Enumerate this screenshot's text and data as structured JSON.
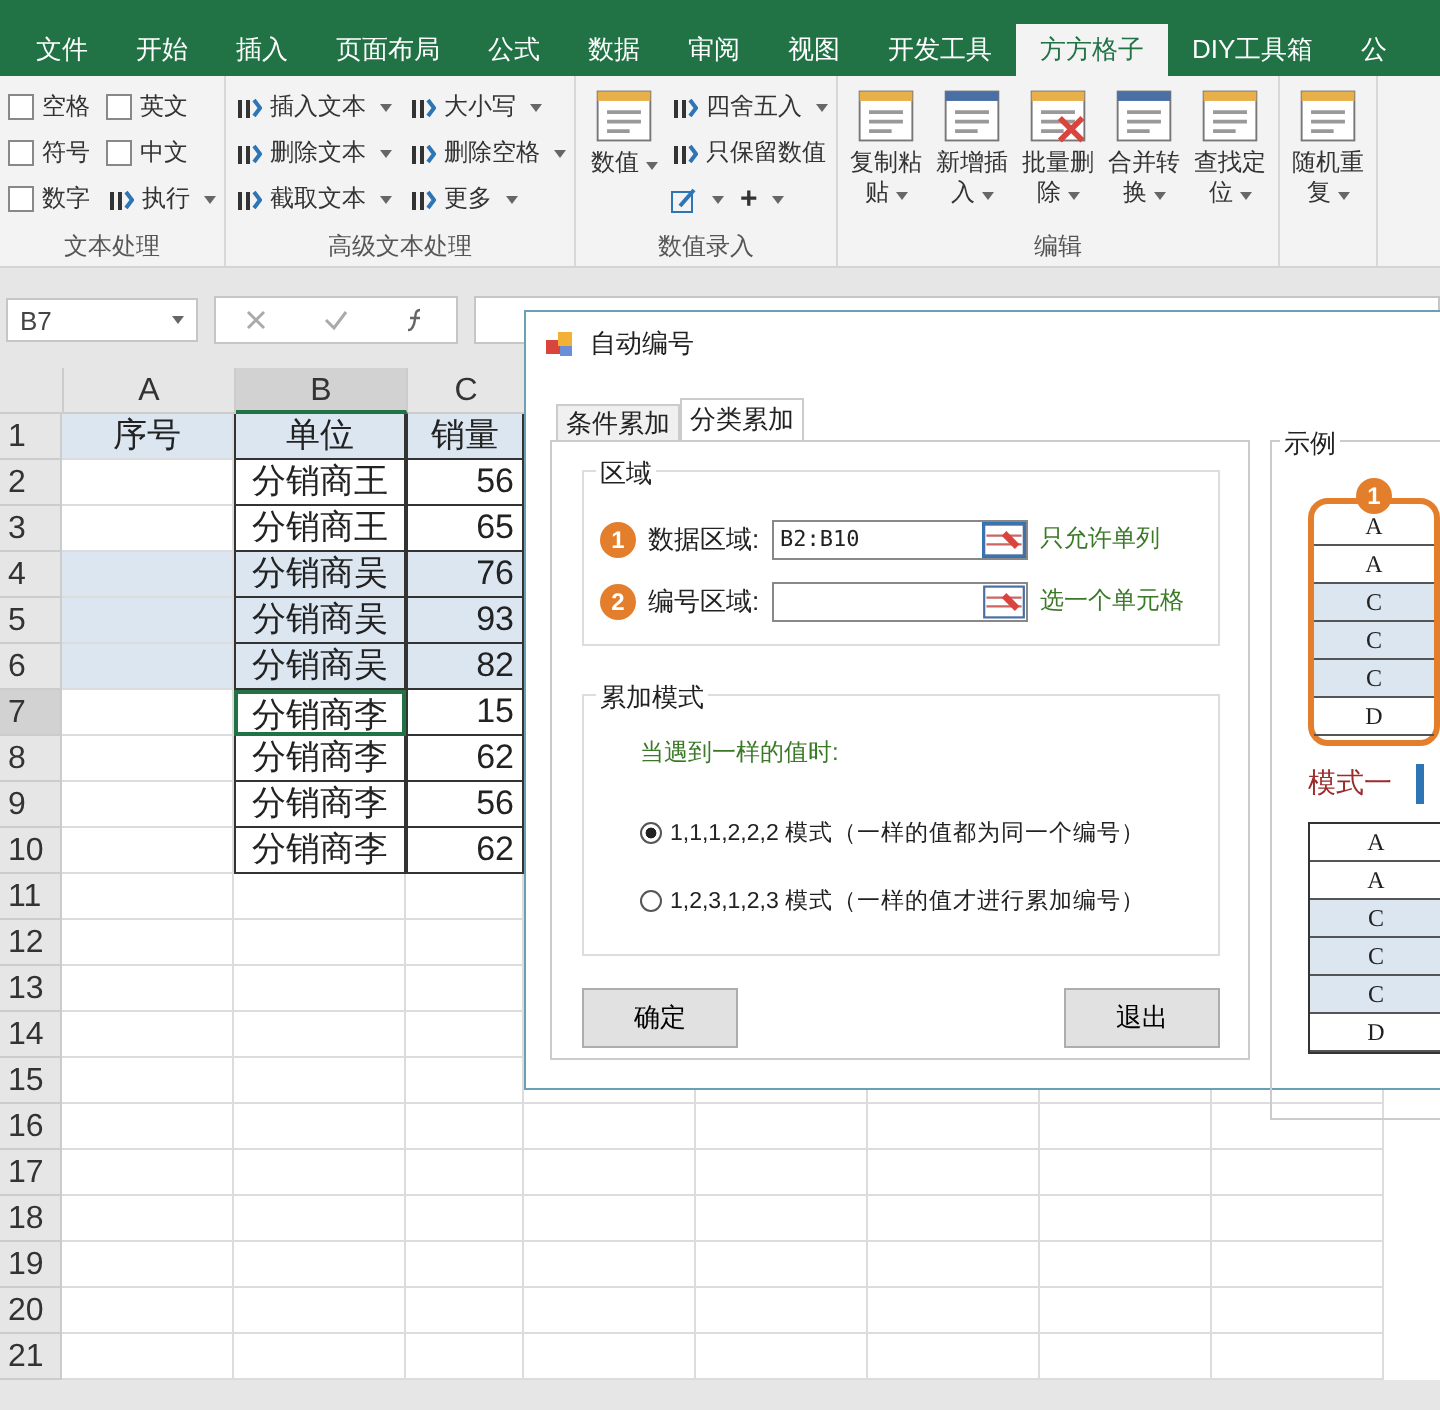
{
  "menu_tabs": [
    {
      "label": "文件",
      "selected": false
    },
    {
      "label": "开始",
      "selected": false
    },
    {
      "label": "插入",
      "selected": false
    },
    {
      "label": "页面布局",
      "selected": false
    },
    {
      "label": "公式",
      "selected": false
    },
    {
      "label": "数据",
      "selected": false
    },
    {
      "label": "审阅",
      "selected": false
    },
    {
      "label": "视图",
      "selected": false
    },
    {
      "label": "开发工具",
      "selected": false
    },
    {
      "label": "方方格子",
      "selected": true
    },
    {
      "label": "DIY工具箱",
      "selected": false
    },
    {
      "label": "公",
      "selected": false
    }
  ],
  "ribbon_groups": [
    {
      "label": "文本处理",
      "items": [
        {
          "kind": "checkbox",
          "label": "空格",
          "checked": false
        },
        {
          "kind": "checkbox",
          "label": "符号",
          "checked": false
        },
        {
          "kind": "checkbox",
          "label": "数字",
          "checked": false
        },
        {
          "kind": "checkbox",
          "label": "英文",
          "checked": false
        },
        {
          "kind": "checkbox",
          "label": "中文",
          "checked": false
        },
        {
          "kind": "small",
          "label": "执行",
          "dropdown": true
        }
      ]
    },
    {
      "label": "高级文本处理",
      "items": [
        {
          "kind": "small",
          "label": "插入文本",
          "dropdown": true
        },
        {
          "kind": "small",
          "label": "删除文本",
          "dropdown": true
        },
        {
          "kind": "small",
          "label": "截取文本",
          "dropdown": true
        },
        {
          "kind": "small",
          "label": "大小写",
          "dropdown": true
        },
        {
          "kind": "small",
          "label": "删除空格",
          "dropdown": true
        },
        {
          "kind": "small",
          "label": "更多",
          "dropdown": true
        }
      ]
    },
    {
      "label": "数值录入",
      "items": [
        {
          "kind": "big",
          "label": "数值",
          "dropdown": true
        },
        {
          "kind": "small",
          "label": "四舍五入",
          "dropdown": true
        },
        {
          "kind": "small",
          "label": "只保留数值",
          "dropdown": false
        },
        {
          "kind": "pair",
          "label": "+",
          "dropdown": true
        }
      ]
    },
    {
      "label": "编辑",
      "items": [
        {
          "kind": "big",
          "label": "复制粘贴",
          "dropdown": true
        },
        {
          "kind": "big",
          "label": "新增插入",
          "dropdown": true
        },
        {
          "kind": "big",
          "label": "批量删除",
          "dropdown": true
        },
        {
          "kind": "big",
          "label": "合并转换",
          "dropdown": true
        },
        {
          "kind": "big",
          "label": "查找定位",
          "dropdown": true
        }
      ]
    },
    {
      "items": [
        {
          "kind": "big",
          "label": "随机重复",
          "dropdown": true
        }
      ]
    }
  ],
  "name_box": "B7",
  "columns": [
    {
      "label": "A",
      "selected": false
    },
    {
      "label": "B",
      "selected": true
    },
    {
      "label": "C",
      "selected": false
    }
  ],
  "rows": [
    {
      "number": "1",
      "kind": "header",
      "selected": false,
      "shaded": true,
      "seq": "序号",
      "unit": "单位",
      "sales": "销量"
    },
    {
      "number": "2",
      "kind": "data",
      "selected": false,
      "shaded": false,
      "unit": "分销商王",
      "sales": "56"
    },
    {
      "number": "3",
      "kind": "data",
      "selected": false,
      "shaded": false,
      "unit": "分销商王",
      "sales": "65"
    },
    {
      "number": "4",
      "kind": "data",
      "selected": false,
      "shaded": true,
      "unit": "分销商吴",
      "sales": "76"
    },
    {
      "number": "5",
      "kind": "data",
      "selected": false,
      "shaded": true,
      "unit": "分销商吴",
      "sales": "93"
    },
    {
      "number": "6",
      "kind": "data",
      "selected": false,
      "shaded": true,
      "unit": "分销商吴",
      "sales": "82"
    },
    {
      "number": "7",
      "kind": "data",
      "selected": true,
      "shaded": false,
      "unit": "分销商李",
      "sales": "15"
    },
    {
      "number": "8",
      "kind": "data",
      "selected": false,
      "shaded": false,
      "unit": "分销商李",
      "sales": "62"
    },
    {
      "number": "9",
      "kind": "data",
      "selected": false,
      "shaded": false,
      "unit": "分销商李",
      "sales": "56"
    },
    {
      "number": "10",
      "kind": "data",
      "selected": false,
      "shaded": false,
      "unit": "分销商李",
      "sales": "62"
    },
    {
      "number": "11",
      "kind": "empty",
      "selected": false,
      "shaded": false
    },
    {
      "number": "12",
      "kind": "empty",
      "selected": false,
      "shaded": false
    },
    {
      "number": "13",
      "kind": "empty",
      "selected": false,
      "shaded": false
    },
    {
      "number": "14",
      "kind": "empty",
      "selected": false,
      "shaded": false
    },
    {
      "number": "15",
      "kind": "empty",
      "selected": false,
      "shaded": false
    },
    {
      "number": "16",
      "kind": "empty",
      "selected": false,
      "shaded": false
    },
    {
      "number": "17",
      "kind": "empty",
      "selected": false,
      "shaded": false
    },
    {
      "number": "18",
      "kind": "empty",
      "selected": false,
      "shaded": false
    },
    {
      "number": "19",
      "kind": "empty",
      "selected": false,
      "shaded": false
    },
    {
      "number": "20",
      "kind": "empty",
      "selected": false,
      "shaded": false
    },
    {
      "number": "21",
      "kind": "empty",
      "selected": false,
      "shaded": false
    }
  ],
  "dialog": {
    "title": "自动编号",
    "tabs": [
      {
        "label": "条件累加",
        "selected": false
      },
      {
        "label": "分类累加",
        "selected": true
      }
    ],
    "range_group": {
      "title": "区域",
      "fields": [
        {
          "badge": "1",
          "label": "数据区域:",
          "value": "B2:B10",
          "hint": "只允许单列"
        },
        {
          "badge": "2",
          "label": "编号区域:",
          "hint": "选一个单元格"
        }
      ]
    },
    "mode_group": {
      "title": "累加模式",
      "prompt": "当遇到一样的值时:",
      "options": [
        {
          "label": "1,1,1,2,2,2 模式（一样的值都为同一个编号）",
          "selected": true
        },
        {
          "label": "1,2,3,1,2,3 模式（一样的值才进行累加编号）",
          "selected": false
        }
      ]
    },
    "buttons": [
      "确定",
      "退出"
    ],
    "example": {
      "title": "示例",
      "badge": "1",
      "source": [
        {
          "text": "A",
          "shaded": false
        },
        {
          "text": "A",
          "shaded": false
        },
        {
          "text": "C",
          "shaded": true
        },
        {
          "text": "C",
          "shaded": true
        },
        {
          "text": "C",
          "shaded": true
        },
        {
          "text": "D",
          "shaded": false
        }
      ],
      "mode_label": "模式一",
      "result": [
        {
          "text": "A",
          "shaded": false
        },
        {
          "text": "A",
          "shaded": false
        },
        {
          "text": "C",
          "shaded": true
        },
        {
          "text": "C",
          "shaded": true
        },
        {
          "text": "C",
          "shaded": true
        },
        {
          "text": "D",
          "shaded": false
        }
      ]
    }
  }
}
